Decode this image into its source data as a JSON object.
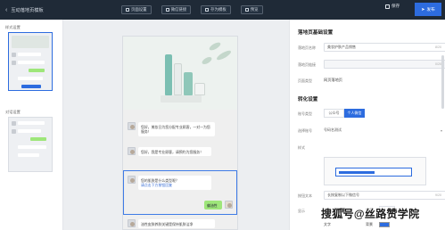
{
  "header": {
    "back_label": "互动落地页模板",
    "buttons": [
      {
        "label": "页面设置"
      },
      {
        "label": "微信链接"
      },
      {
        "label": "存为模板"
      },
      {
        "label": "预览"
      }
    ],
    "save_label": "保存",
    "publish_label": "发布"
  },
  "left_panel": {
    "section1_label": "样式设置",
    "section2_label": "对话设置"
  },
  "phone": {
    "messages": [
      {
        "text": "您好，美妆日为您分配专业顾客，一对一为您服务！"
      },
      {
        "text": "您好，我是专业顾客，请预约为您服务！"
      },
      {
        "text": "您的肌肤是什么类型呢？",
        "link": "请点击下方按钮回复"
      },
      {
        "text": "偏油性"
      },
      {
        "text": "油性皮肤养肤关键是保持肌肤洁净"
      }
    ]
  },
  "settings": {
    "title": "落地页基础设置",
    "name_label": "落地页名称",
    "name_value": "美妆护肤产品销售",
    "name_count": "8/20",
    "url_label": "落地页链接",
    "url_count": "0/20",
    "type_label": "页面类型",
    "type_value": "网页落地页",
    "convert_title": "转化设置",
    "account_label": "账号类型",
    "account_options": [
      "公众号",
      "个人微信"
    ],
    "account_selected": "个人微信",
    "select_label": "选择账号",
    "select_value": "号码名测试",
    "style_label": "样式",
    "button_label": "按钮文本",
    "button_value": "长按复制以下微信号",
    "button_count": "9/20",
    "display_label": "显示",
    "text_label": "文字",
    "size_label": "字号",
    "size_value": "14",
    "bottom_label": "背景",
    "bottom_label2": "文字"
  },
  "watermark": "搜狐号@丝路赞学院",
  "colors": {
    "accent": "#2d6cdf",
    "topbar": "#1f2a37",
    "bubble_green": "#9ee67a"
  }
}
